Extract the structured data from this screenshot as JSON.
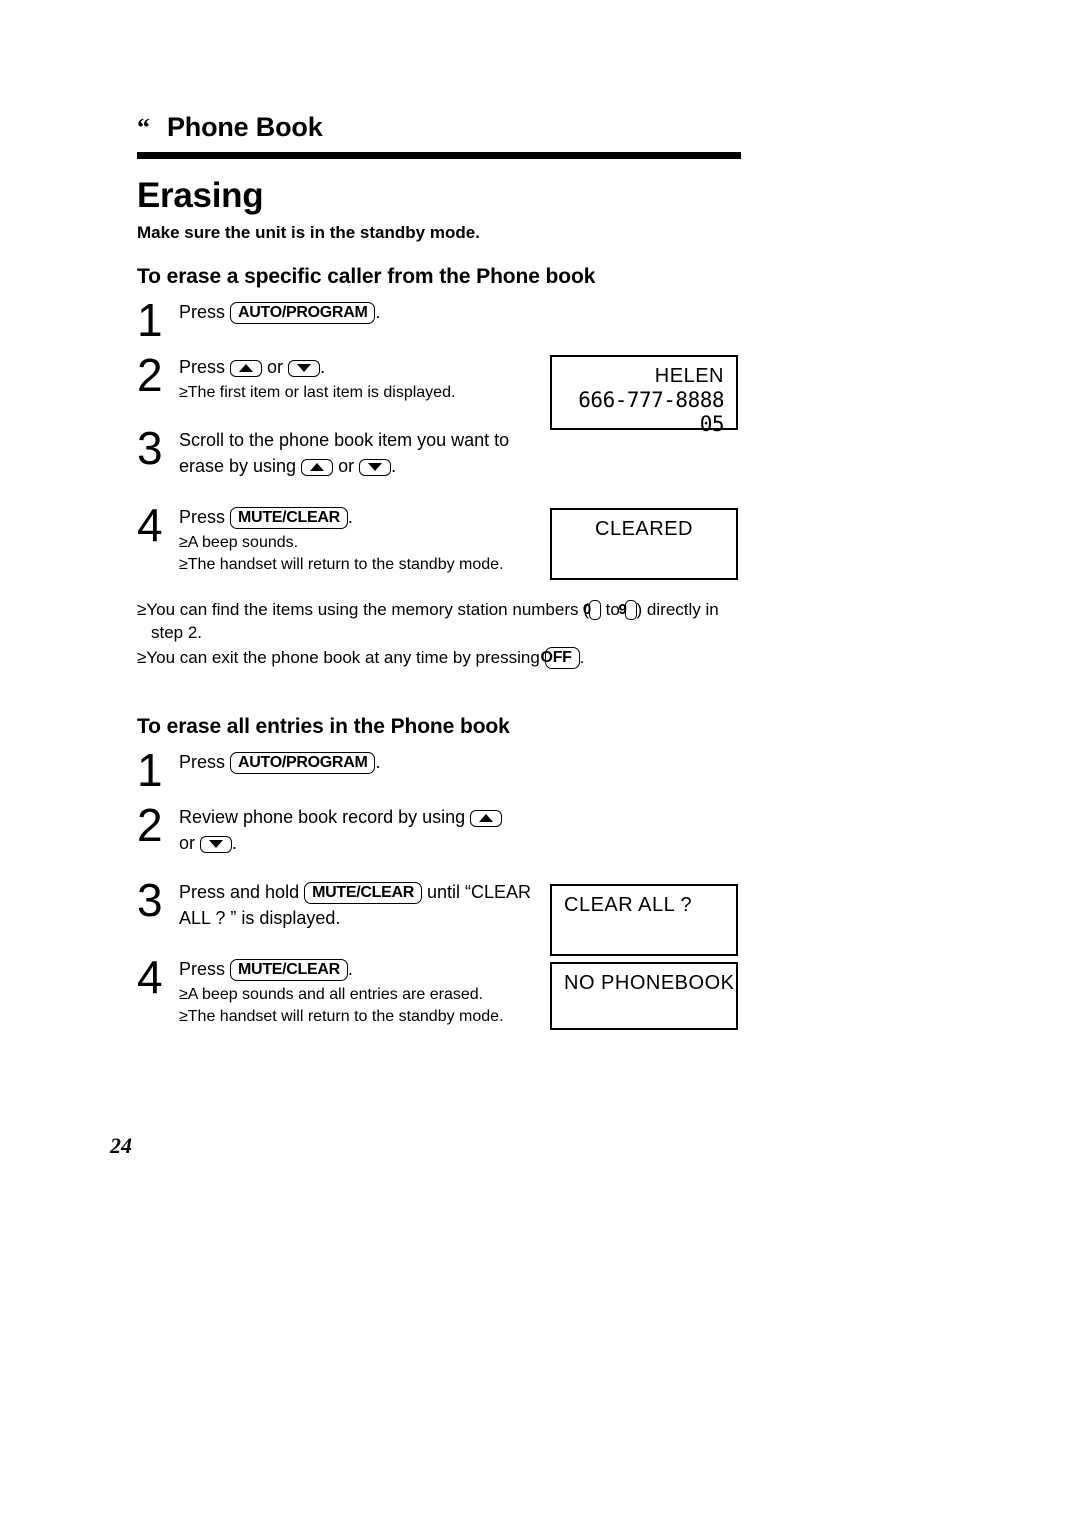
{
  "header": {
    "mark": "“",
    "title": "Phone Book"
  },
  "chapter_title": "Erasing",
  "lead_note": "Make sure the unit is in the standby mode.",
  "sections": [
    {
      "title": "To erase a specific caller from the Phone book",
      "steps": [
        {
          "number": "1",
          "press_label": "Press",
          "key": "AUTO/PROGRAM",
          "after": ".",
          "subs": []
        },
        {
          "number": "2",
          "press_label": "Press",
          "or_label": "or",
          "after": ".",
          "subs": [
            "The first item or last item is displayed."
          ]
        },
        {
          "number": "3",
          "line1": "Scroll to the phone book item you want to",
          "line2_prefix": "erase by using",
          "or_label": "or",
          "after": ".",
          "subs": []
        },
        {
          "number": "4",
          "press_label": "Press",
          "key": "MUTE/CLEAR",
          "after": ".",
          "subs": [
            "A beep sounds.",
            "The handset will return to the standby mode."
          ]
        }
      ]
    },
    {
      "title": "To erase all entries in the Phone book",
      "steps": [
        {
          "number": "1",
          "press_label": "Press",
          "key": "AUTO/PROGRAM",
          "after": ".",
          "subs": []
        },
        {
          "number": "2",
          "line1_prefix": "Review phone book record by using",
          "line2_prefix": "or",
          "after": ".",
          "subs": []
        },
        {
          "number": "3",
          "prefix": "Press and hold",
          "key": "MUTE/CLEAR",
          "middle": "until “CLEAR",
          "line2": "ALL ? ” is displayed.",
          "subs": []
        },
        {
          "number": "4",
          "press_label": "Press",
          "key": "MUTE/CLEAR",
          "after": ".",
          "subs": [
            "A beep sounds and all entries are erased.",
            "The handset will return to the standby mode."
          ]
        }
      ]
    }
  ],
  "notes": {
    "bullet": "≥",
    "note1_part1": "You can find the items using the memory station numbers (",
    "note1_key_from": "0",
    "note1_mid": "to",
    "note1_key_to": "9",
    "note1_part2": ") directly in",
    "note1_line2": "step 2.",
    "note2_part1": "You can exit the phone book at any time by pressing",
    "note2_key": "OFF",
    "note2_part2": "."
  },
  "lcd_displays": {
    "helen": {
      "line1": "HELEN",
      "line2": "666-777-8888",
      "line3": "05"
    },
    "cleared": {
      "line1": "CLEARED"
    },
    "clear_all": {
      "line1": "CLEAR ALL ?"
    },
    "no_phonebook": {
      "line1": "NO PHONEBOOK"
    }
  },
  "page_number": "24",
  "sub_bullet": "≥"
}
